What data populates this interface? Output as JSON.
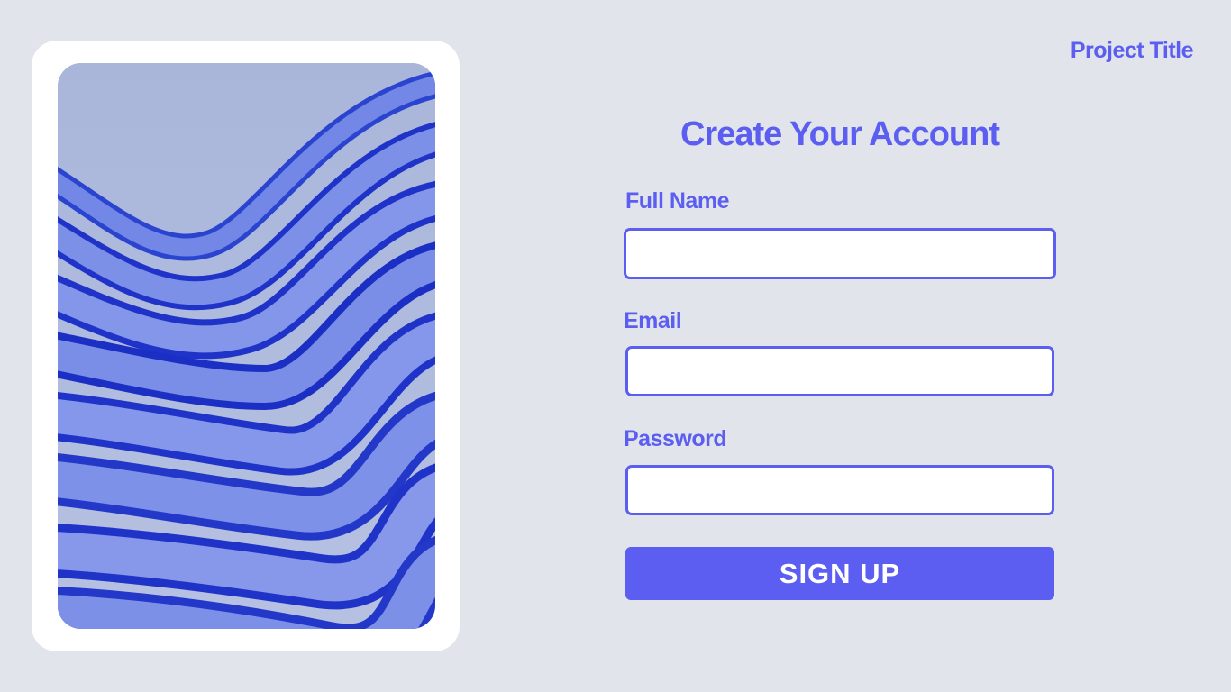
{
  "header": {
    "project_title": "Project Title"
  },
  "form": {
    "title": "Create Your Account",
    "fields": [
      {
        "label": "Full Name",
        "value": "",
        "placeholder": ""
      },
      {
        "label": "Email",
        "value": "",
        "placeholder": ""
      },
      {
        "label": "Password",
        "value": "",
        "placeholder": ""
      }
    ],
    "submit_label": "SIGN UP"
  },
  "hero_image": {
    "subject": "abstract-blue-waves"
  },
  "colors": {
    "accent": "#5b5ef0",
    "background": "#e1e5eb",
    "card": "#ffffff",
    "wave_dark": "#1f33c8",
    "wave_light": "#7f92e6"
  }
}
